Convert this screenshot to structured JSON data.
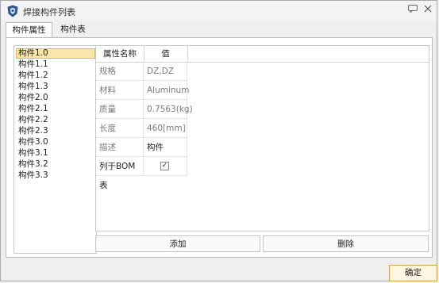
{
  "window": {
    "title": "焊接构件列表"
  },
  "tabs": [
    {
      "label": "构件属性"
    },
    {
      "label": "构件表"
    }
  ],
  "tree": {
    "items": [
      "构件1.0",
      "构件1.1",
      "构件1.2",
      "构件1.3",
      "构件2.0",
      "构件2.1",
      "构件2.2",
      "构件2.3",
      "构件3.0",
      "构件3.1",
      "构件3.2",
      "构件3.3"
    ],
    "selected_index": 0
  },
  "grid": {
    "headers": [
      "属性名称",
      "值"
    ],
    "rows": [
      {
        "key": "规格",
        "value": "DZ,DZ"
      },
      {
        "key": "材料",
        "value": "Aluminum"
      },
      {
        "key": "质量",
        "value": "0.7563(kg)"
      },
      {
        "key": "长度",
        "value": "460[mm]"
      },
      {
        "key": "描述",
        "value": "构件"
      },
      {
        "key": "列于BOM表",
        "value": "✓",
        "checked": true
      }
    ]
  },
  "buttons": {
    "add": "添加",
    "delete": "删除",
    "ok": "确定"
  },
  "titlebar_icons": [
    "chat-icon",
    "close-icon"
  ],
  "colors": {
    "selection_bg": "#fbe6a9",
    "selection_border": "#e9b64a",
    "accent": "#c9a24a"
  }
}
